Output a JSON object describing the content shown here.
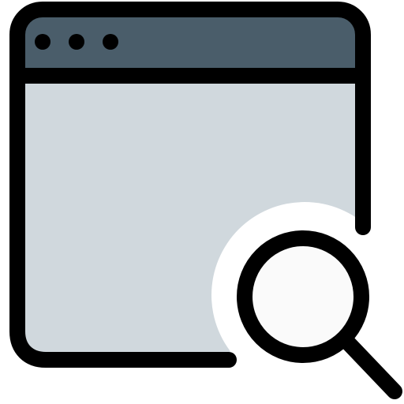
{
  "icon": {
    "name": "browser-window-search-icon",
    "colors": {
      "outline": "#000000",
      "title_bar": "#4a5d6a",
      "window_body": "#d0d8dd",
      "lens_glass": "#fafafa",
      "cutout": "#ffffff"
    }
  }
}
